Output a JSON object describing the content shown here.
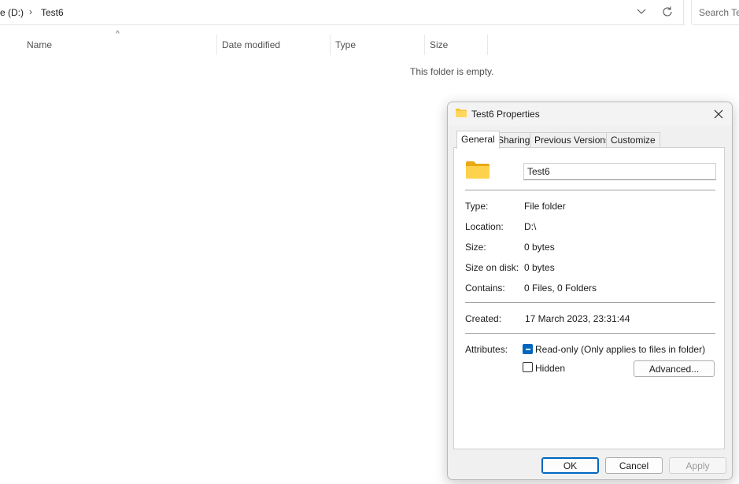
{
  "explorer": {
    "breadcrumb": {
      "drive": "e (D:)",
      "separator": "›",
      "folder": "Test6"
    },
    "search": {
      "placeholder": "Search Tes"
    },
    "columns": [
      {
        "label": "Name"
      },
      {
        "label": "Date modified"
      },
      {
        "label": "Type"
      },
      {
        "label": "Size"
      }
    ],
    "empty_message": "This folder is empty."
  },
  "dialog": {
    "title": "Test6 Properties",
    "tabs": [
      {
        "label": "General",
        "active": true
      },
      {
        "label": "Sharing",
        "active": false
      },
      {
        "label": "Previous Versions",
        "active": false
      },
      {
        "label": "Customize",
        "active": false
      }
    ],
    "name_value": "Test6",
    "properties": {
      "type": {
        "label": "Type:",
        "value": "File folder"
      },
      "location": {
        "label": "Location:",
        "value": "D:\\"
      },
      "size": {
        "label": "Size:",
        "value": "0 bytes"
      },
      "size_on_disk": {
        "label": "Size on disk:",
        "value": "0 bytes"
      },
      "contains": {
        "label": "Contains:",
        "value": "0 Files, 0 Folders"
      },
      "created": {
        "label": "Created:",
        "value": "17 March 2023, 23:31:44"
      }
    },
    "attributes": {
      "label": "Attributes:",
      "readonly": {
        "label": "Read-only (Only applies to files in folder)",
        "state": "indeterminate"
      },
      "hidden": {
        "label": "Hidden",
        "state": "unchecked"
      },
      "advanced_button": "Advanced..."
    },
    "buttons": {
      "ok": "OK",
      "cancel": "Cancel",
      "apply": "Apply"
    }
  },
  "colors": {
    "accent": "#0067c0",
    "folder_yellow": "#f8c43a",
    "dialog_bg": "#f0f0f0"
  }
}
